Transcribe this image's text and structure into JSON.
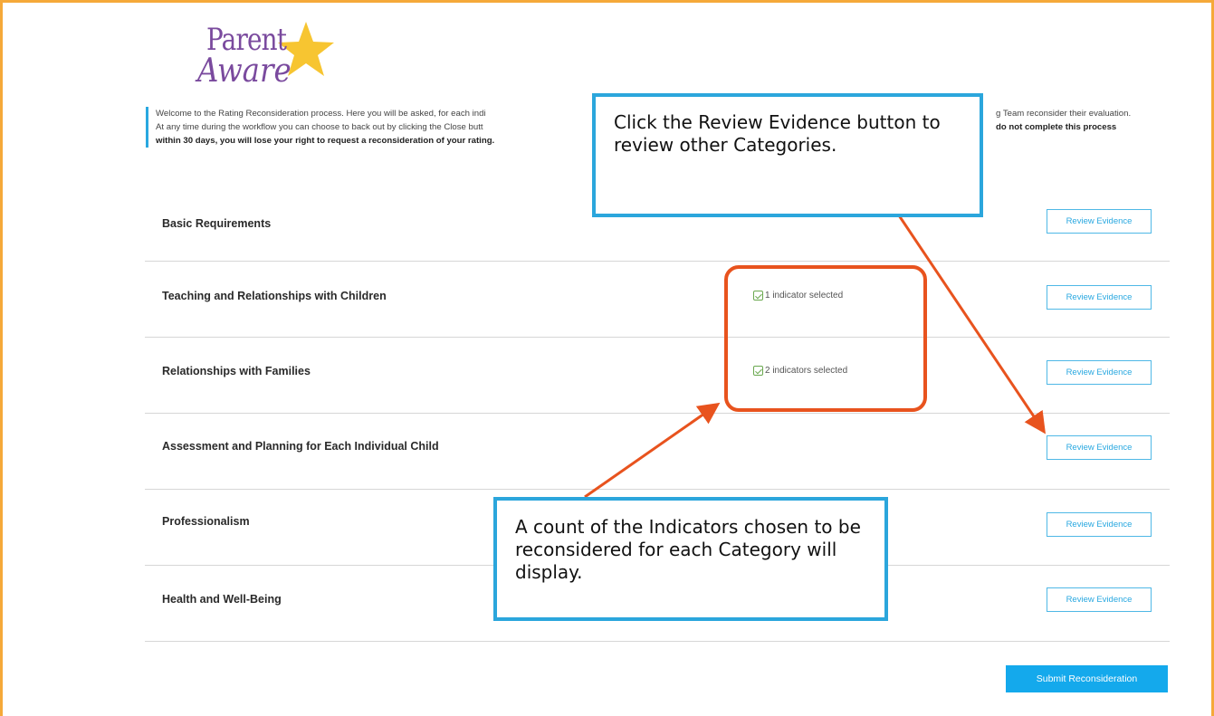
{
  "logo": {
    "line1": "Parent",
    "line2": "Aware"
  },
  "intro": {
    "line1_left": "Welcome to the Rating Reconsideration process. Here you will be asked, for each indi",
    "line1_right": "g Team reconsider their evaluation.",
    "line2_left": "At any time during the workflow you can choose to back out by clicking the Close butt",
    "line2_right": "do not complete this process",
    "line3_left": "within 30 days, you will lose your right to request a reconsideration of your rating."
  },
  "categories": [
    {
      "label": "Basic Requirements",
      "indicator": "",
      "button": "Review Evidence"
    },
    {
      "label": "Teaching and Relationships with Children",
      "indicator": "1 indicator selected",
      "button": "Review Evidence"
    },
    {
      "label": "Relationships with Families",
      "indicator": "2 indicators selected",
      "button": "Review Evidence"
    },
    {
      "label": "Assessment and Planning for Each Individual Child",
      "indicator": "",
      "button": "Review Evidence"
    },
    {
      "label": "Professionalism",
      "indicator": "",
      "button": "Review Evidence"
    },
    {
      "label": "Health and Well-Being",
      "indicator": "",
      "button": "Review Evidence"
    }
  ],
  "submit_label": "Submit Reconsideration",
  "callouts": {
    "top": "Click the Review Evidence button to review other Categories.",
    "bottom": "A count of the Indicators chosen to be reconsidered for each Category will display."
  },
  "colors": {
    "frame": "#f5a93a",
    "accent": "#29a8e0",
    "callout_border": "#2ba6dc",
    "annotation": "#e8531e",
    "check": "#6aa84f",
    "logo": "#7a4a9e",
    "star": "#f7c531"
  }
}
